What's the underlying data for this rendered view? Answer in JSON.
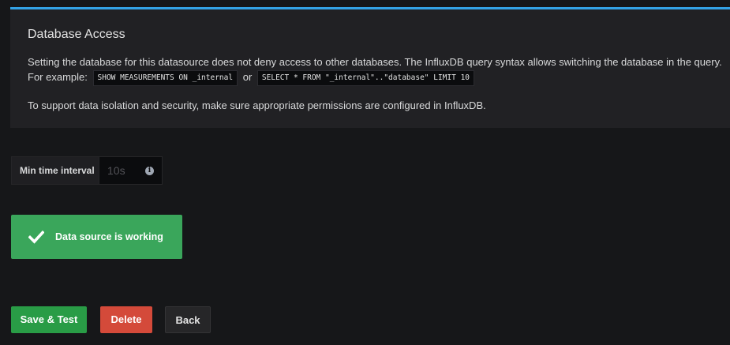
{
  "info": {
    "title": "Database Access",
    "line1": "Setting the database for this datasource does not deny access to other databases. The InfluxDB query syntax allows switching the database in the query.",
    "example_prefix": "For example:",
    "code1": "SHOW MEASUREMENTS ON _internal",
    "or_text": "or",
    "code2": "SELECT * FROM \"_internal\"..\"database\" LIMIT 10",
    "line2": "To support data isolation and security, make sure appropriate permissions are configured in InfluxDB.",
    "accent_color": "#33a2e5"
  },
  "min_time_interval": {
    "label": "Min time interval",
    "placeholder": "10s",
    "value": "",
    "icon": "info-circle-icon"
  },
  "status": {
    "text": "Data source is working",
    "icon": "check-icon",
    "color": "#3aa65b"
  },
  "buttons": {
    "save_label": "Save & Test",
    "delete_label": "Delete",
    "back_label": "Back"
  },
  "colors": {
    "background": "#161719",
    "panel": "#212124",
    "save": "#299c46",
    "delete": "#d44a3a"
  }
}
